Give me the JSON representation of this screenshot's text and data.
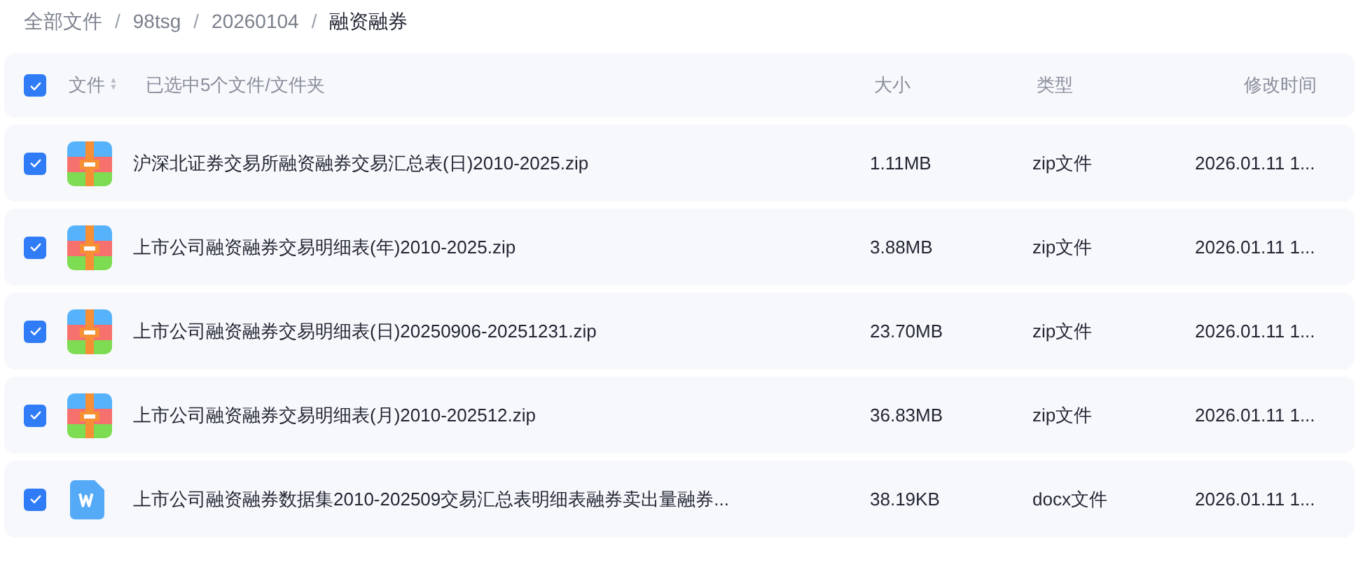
{
  "breadcrumb": [
    {
      "label": "全部文件",
      "current": false
    },
    {
      "label": "98tsg",
      "current": false
    },
    {
      "label": "20260104",
      "current": false
    },
    {
      "label": "融资融券",
      "current": true
    }
  ],
  "breadcrumb_separator": "/",
  "header": {
    "checked": true,
    "name_column": "文件",
    "sort_icon": "▲▼",
    "selection_text": "已选中5个文件/文件夹",
    "columns": [
      "大小",
      "类型",
      "修改时间"
    ]
  },
  "files": [
    {
      "kind": "zip",
      "checked": true,
      "name": "沪深北证券交易所融资融券交易汇总表(日)2010-2025.zip",
      "size": "1.11MB",
      "type": "zip文件",
      "modified": "2026.01.11 1..."
    },
    {
      "kind": "zip",
      "checked": true,
      "name": "上市公司融资融券交易明细表(年)2010-2025.zip",
      "size": "3.88MB",
      "type": "zip文件",
      "modified": "2026.01.11 1..."
    },
    {
      "kind": "zip",
      "checked": true,
      "name": "上市公司融资融券交易明细表(日)20250906-20251231.zip",
      "size": "23.70MB",
      "type": "zip文件",
      "modified": "2026.01.11 1..."
    },
    {
      "kind": "zip",
      "checked": true,
      "name": "上市公司融资融券交易明细表(月)2010-202512.zip",
      "size": "36.83MB",
      "type": "zip文件",
      "modified": "2026.01.11 1..."
    },
    {
      "kind": "docx",
      "checked": true,
      "name": "上市公司融资融券数据集2010-202509交易汇总表明细表融券卖出量融券...",
      "size": "38.19KB",
      "type": "docx文件",
      "modified": "2026.01.11 1..."
    }
  ]
}
